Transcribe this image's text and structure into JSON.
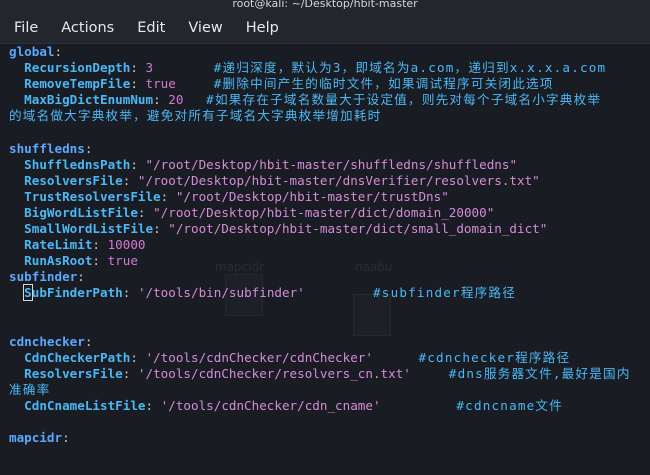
{
  "window": {
    "title": "root@kali: ~/Desktop/hbit-master"
  },
  "menu": [
    "File",
    "Actions",
    "Edit",
    "View",
    "Help"
  ],
  "background_ghosts": [
    "mapcidr",
    "naabu"
  ],
  "colors": {
    "key": "#4bb8f5",
    "section": "#5aa8ff",
    "string": "#d48bd8",
    "number": "#d07ad2",
    "comment": "#4bb8f5"
  },
  "lines": [
    [
      {
        "t": "global",
        "c": "k0"
      },
      {
        "t": ":",
        "c": "p"
      }
    ],
    [
      {
        "t": "  RecursionDepth",
        "c": "k1"
      },
      {
        "t": ": ",
        "c": "p"
      },
      {
        "t": "3",
        "c": "n"
      },
      {
        "t": "        ",
        "c": "p"
      },
      {
        "t": "#递归深度，默认为3，即域名为a.com，递归到x.x.x.a.com",
        "c": "c"
      }
    ],
    [
      {
        "t": "  RemoveTempFile",
        "c": "k1"
      },
      {
        "t": ": ",
        "c": "p"
      },
      {
        "t": "true",
        "c": "b"
      },
      {
        "t": "     ",
        "c": "p"
      },
      {
        "t": "#删除中间产生的临时文件，如果调试程序可关闭此选项",
        "c": "c"
      }
    ],
    [
      {
        "t": "  MaxBigDictEnumNum",
        "c": "k1"
      },
      {
        "t": ": ",
        "c": "p"
      },
      {
        "t": "20",
        "c": "n"
      },
      {
        "t": "   ",
        "c": "p"
      },
      {
        "t": "#如果存在子域名数量大于设定值，则先对每个子域名小字典枚举",
        "c": "c"
      }
    ],
    [
      {
        "t": "的域名做大字典枚举，避免对所有子域名大字典枚举增加耗时",
        "c": "c"
      }
    ],
    [],
    [
      {
        "t": "shuffledns",
        "c": "k0"
      },
      {
        "t": ":",
        "c": "p"
      }
    ],
    [
      {
        "t": "  ShufflednsPath",
        "c": "k1"
      },
      {
        "t": ": ",
        "c": "p"
      },
      {
        "t": "\"/root/Desktop/hbit-master/shuffledns/shuffledns\"",
        "c": "s"
      }
    ],
    [
      {
        "t": "  ResolversFile",
        "c": "k1"
      },
      {
        "t": ": ",
        "c": "p"
      },
      {
        "t": "\"/root/Desktop/hbit-master/dnsVerifier/resolvers.txt\"",
        "c": "s"
      }
    ],
    [
      {
        "t": "  TrustResolversFile",
        "c": "k1"
      },
      {
        "t": ": ",
        "c": "p"
      },
      {
        "t": "\"/root/Desktop/hbit-master/trustDns\"",
        "c": "s"
      }
    ],
    [
      {
        "t": "  BigWordListFile",
        "c": "k1"
      },
      {
        "t": ": ",
        "c": "p"
      },
      {
        "t": "\"/root/Desktop/hbit-master/dict/domain_20000\"",
        "c": "s"
      }
    ],
    [
      {
        "t": "  SmallWordListFile",
        "c": "k1"
      },
      {
        "t": ": ",
        "c": "p"
      },
      {
        "t": "\"/root/Desktop/hbit-master/dict/small_domain_dict\"",
        "c": "s"
      }
    ],
    [
      {
        "t": "  RateLimit",
        "c": "k1"
      },
      {
        "t": ": ",
        "c": "p"
      },
      {
        "t": "10000",
        "c": "n"
      }
    ],
    [
      {
        "t": "  RunAsRoot",
        "c": "k1"
      },
      {
        "t": ": ",
        "c": "p"
      },
      {
        "t": "true",
        "c": "b"
      }
    ],
    [
      {
        "t": "subfinder",
        "c": "k0"
      },
      {
        "t": ":",
        "c": "p"
      }
    ],
    [
      {
        "t": "  ",
        "c": "p"
      },
      {
        "t": "S",
        "c": "k1 cursor-outline"
      },
      {
        "t": "ubFinderPath",
        "c": "k1"
      },
      {
        "t": ": ",
        "c": "p"
      },
      {
        "t": "'/tools/bin/subfinder'",
        "c": "s"
      },
      {
        "t": "         ",
        "c": "p"
      },
      {
        "t": "#subfinder程序路径",
        "c": "c"
      }
    ],
    [],
    [],
    [
      {
        "t": "cdnchecker",
        "c": "k0"
      },
      {
        "t": ":",
        "c": "p"
      }
    ],
    [
      {
        "t": "  CdnCheckerPath",
        "c": "k1"
      },
      {
        "t": ": ",
        "c": "p"
      },
      {
        "t": "'/tools/cdnChecker/cdnChecker'",
        "c": "s"
      },
      {
        "t": "      ",
        "c": "p"
      },
      {
        "t": "#cdnchecker程序路径",
        "c": "c"
      }
    ],
    [
      {
        "t": "  ResolversFile",
        "c": "k1"
      },
      {
        "t": ": ",
        "c": "p"
      },
      {
        "t": "'/tools/cdnChecker/resolvers_cn.txt'",
        "c": "s"
      },
      {
        "t": "     ",
        "c": "p"
      },
      {
        "t": "#dns服务器文件,最好是国内",
        "c": "c"
      }
    ],
    [
      {
        "t": "准确率",
        "c": "c"
      }
    ],
    [
      {
        "t": "  CdnCnameListFile",
        "c": "k1"
      },
      {
        "t": ": ",
        "c": "p"
      },
      {
        "t": "'/tools/cdnChecker/cdn_cname'",
        "c": "s"
      },
      {
        "t": "          ",
        "c": "p"
      },
      {
        "t": "#cdncname文件",
        "c": "c"
      }
    ],
    [],
    [
      {
        "t": "mapcidr",
        "c": "k0"
      },
      {
        "t": ":",
        "c": "p"
      }
    ]
  ]
}
